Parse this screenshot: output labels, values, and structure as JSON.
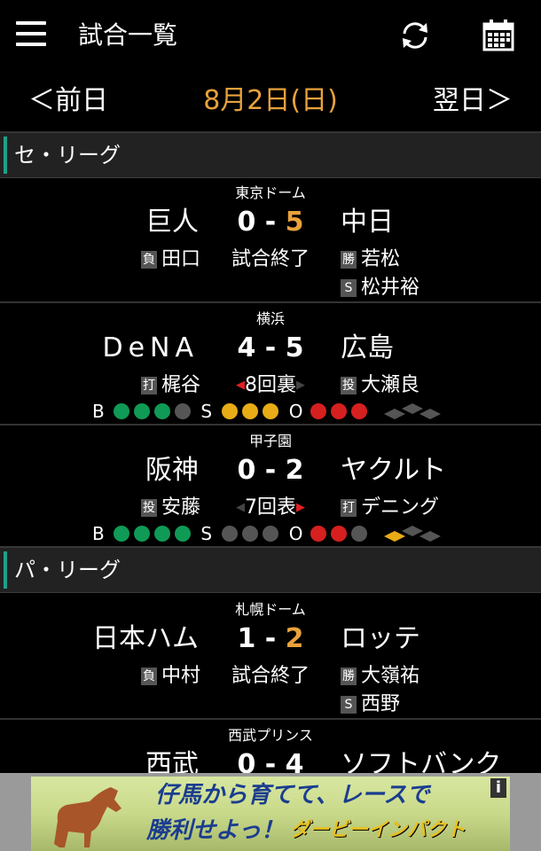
{
  "header": {
    "title": "試合一覧",
    "menu_icon": "hamburger-icon",
    "refresh_icon": "refresh-icon",
    "calendar_icon": "calendar-icon"
  },
  "datebar": {
    "prev_label": "＜前日",
    "current_date": "8月2日(日)",
    "next_label": "翌日＞",
    "date_color": "#e8a23c"
  },
  "leagues": [
    {
      "name": "セ・リーグ",
      "games": [
        {
          "venue": "東京ドーム",
          "home": "巨人",
          "away": "中日",
          "home_score": "0",
          "away_score": "5",
          "sep": "-",
          "status": "試合終了",
          "left_tag": "負",
          "left_player": "田口",
          "right_tag1": "勝",
          "right_player1": "若松",
          "right_tag2": "S",
          "right_player2": "松井裕"
        },
        {
          "venue": "横浜",
          "home": "DeNA",
          "away": "広島",
          "home_score": "4",
          "away_score": "5",
          "sep": "-",
          "status": "8回裏",
          "left_tag": "打",
          "left_player": "梶谷",
          "right_tag1": "投",
          "right_player1": "大瀬良",
          "bso": {
            "b_label": "B",
            "s_label": "S",
            "o_label": "O",
            "balls": 3,
            "strikes": 3,
            "outs": 3
          }
        },
        {
          "venue": "甲子園",
          "home": "阪神",
          "away": "ヤクルト",
          "home_score": "0",
          "away_score": "2",
          "sep": "-",
          "status": "7回表",
          "left_tag": "投",
          "left_player": "安藤",
          "right_tag1": "打",
          "right_player1": "デニング",
          "bso": {
            "b_label": "B",
            "s_label": "S",
            "o_label": "O",
            "balls": 4,
            "strikes": 0,
            "outs": 2
          }
        }
      ]
    },
    {
      "name": "パ・リーグ",
      "games": [
        {
          "venue": "札幌ドーム",
          "home": "日本ハム",
          "away": "ロッテ",
          "home_score": "1",
          "away_score": "2",
          "sep": "-",
          "status": "試合終了",
          "left_tag": "負",
          "left_player": "中村",
          "right_tag1": "勝",
          "right_player1": "大嶺祐",
          "right_tag2": "S",
          "right_player2": "西野"
        },
        {
          "venue": "西武プリンス",
          "home": "西武",
          "away": "ソフトバンク",
          "home_score": "0",
          "away_score": "4",
          "sep": "-"
        }
      ]
    }
  ],
  "colors": {
    "accent": "#e8a23c",
    "league_bar": "#1fa08a",
    "ball": "#0f9a55",
    "strike": "#e8ac16",
    "out": "#d6201f"
  },
  "ad": {
    "line1": "仔馬から育てて、レースで",
    "line2": "勝利せよっ！",
    "logo": "ダービーインパクト",
    "info": "i"
  }
}
